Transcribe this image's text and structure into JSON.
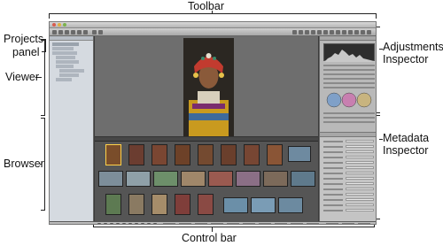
{
  "callouts": {
    "toolbar": "Toolbar",
    "projects_panel_line1": "Projects",
    "projects_panel_line2": "panel",
    "viewer": "Viewer",
    "browser": "Browser",
    "control_bar": "Control bar",
    "adjustments_line1": "Adjustments",
    "adjustments_line2": "Inspector",
    "metadata_line1": "Metadata",
    "metadata_line2": "Inspector"
  },
  "colors": {
    "window_bg": "#3b3b3b",
    "viewer_bg": "#6e6e6e",
    "browser_bg": "#555555",
    "projects_bg": "#d5dae0",
    "inspector_bg": "#b9b9b9",
    "selection": "#ffd24a"
  },
  "icons": {
    "close": "close-dot-icon",
    "minimize": "minimize-dot-icon",
    "zoom": "zoom-dot-icon"
  }
}
